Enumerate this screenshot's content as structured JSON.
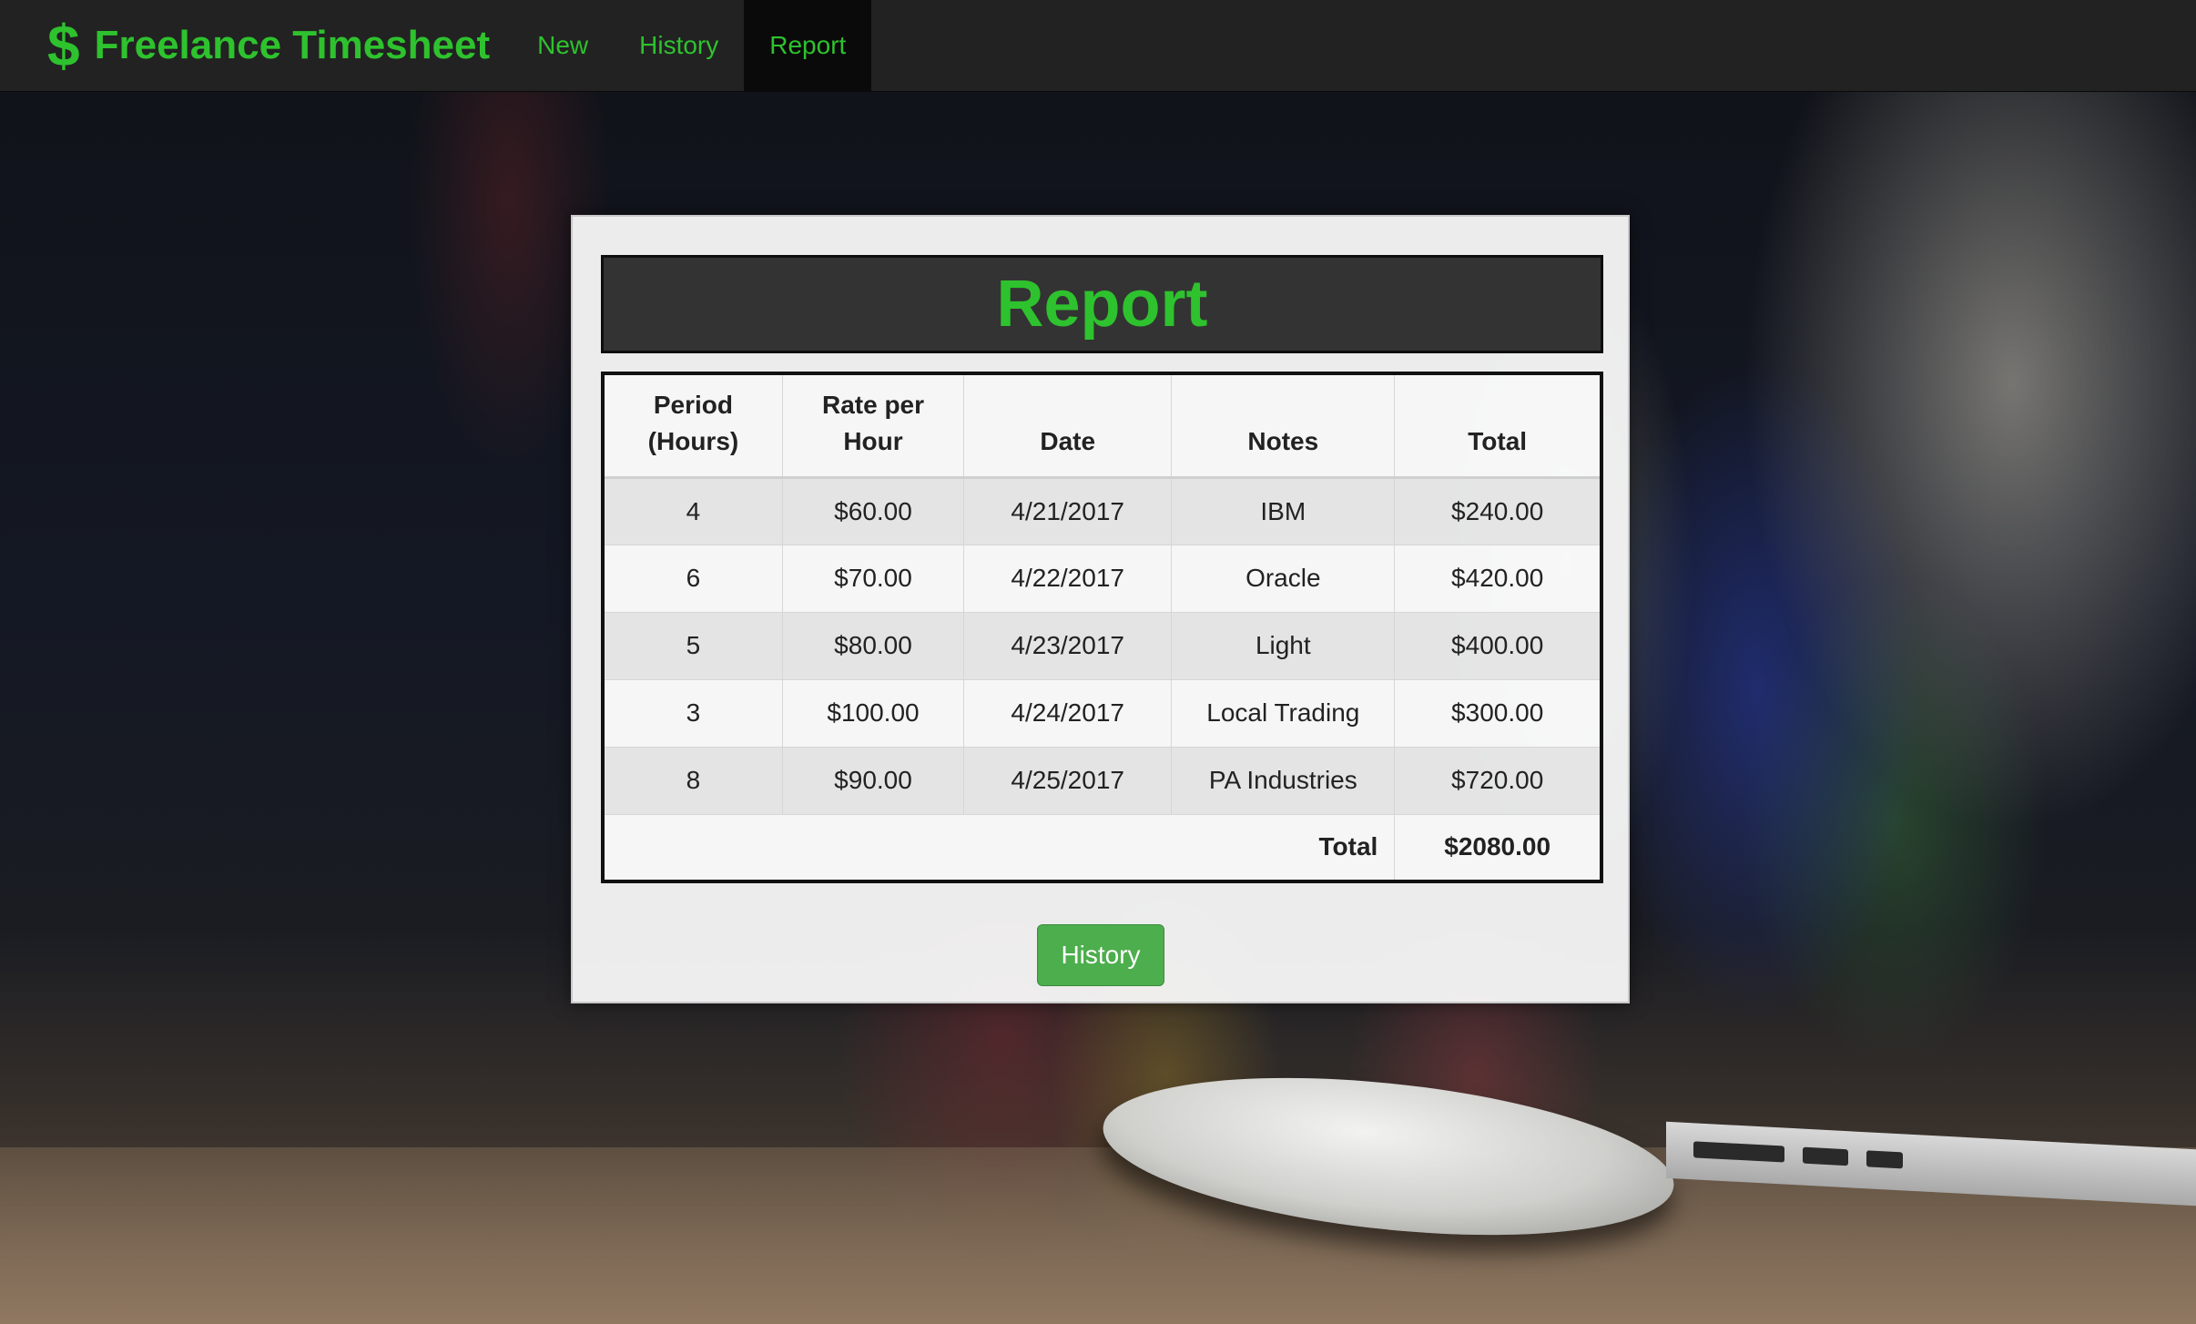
{
  "app": {
    "brand": "Freelance Timesheet",
    "brand_icon": "$",
    "accent_color": "#2ec22e",
    "button_color": "#4cae4c"
  },
  "nav": {
    "items": [
      {
        "label": "New",
        "active": false
      },
      {
        "label": "History",
        "active": false
      },
      {
        "label": "Report",
        "active": true
      }
    ]
  },
  "report": {
    "title": "Report",
    "columns": [
      "Period (Hours)",
      "Rate per Hour",
      "Date",
      "Notes",
      "Total"
    ],
    "columns_split": [
      [
        "Period",
        "(Hours)"
      ],
      [
        "Rate per",
        "Hour"
      ],
      [
        "Date"
      ],
      [
        "Notes"
      ],
      [
        "Total"
      ]
    ],
    "rows": [
      {
        "hours": "4",
        "rate": "$60.00",
        "date": "4/21/2017",
        "notes": "IBM",
        "total": "$240.00"
      },
      {
        "hours": "6",
        "rate": "$70.00",
        "date": "4/22/2017",
        "notes": "Oracle",
        "total": "$420.00"
      },
      {
        "hours": "5",
        "rate": "$80.00",
        "date": "4/23/2017",
        "notes": "Light",
        "total": "$400.00"
      },
      {
        "hours": "3",
        "rate": "$100.00",
        "date": "4/24/2017",
        "notes": "Local Trading",
        "total": "$300.00"
      },
      {
        "hours": "8",
        "rate": "$90.00",
        "date": "4/25/2017",
        "notes": "PA Industries",
        "total": "$720.00"
      }
    ],
    "total_label": "Total",
    "total_value": "$2080.00",
    "history_button": "History"
  }
}
